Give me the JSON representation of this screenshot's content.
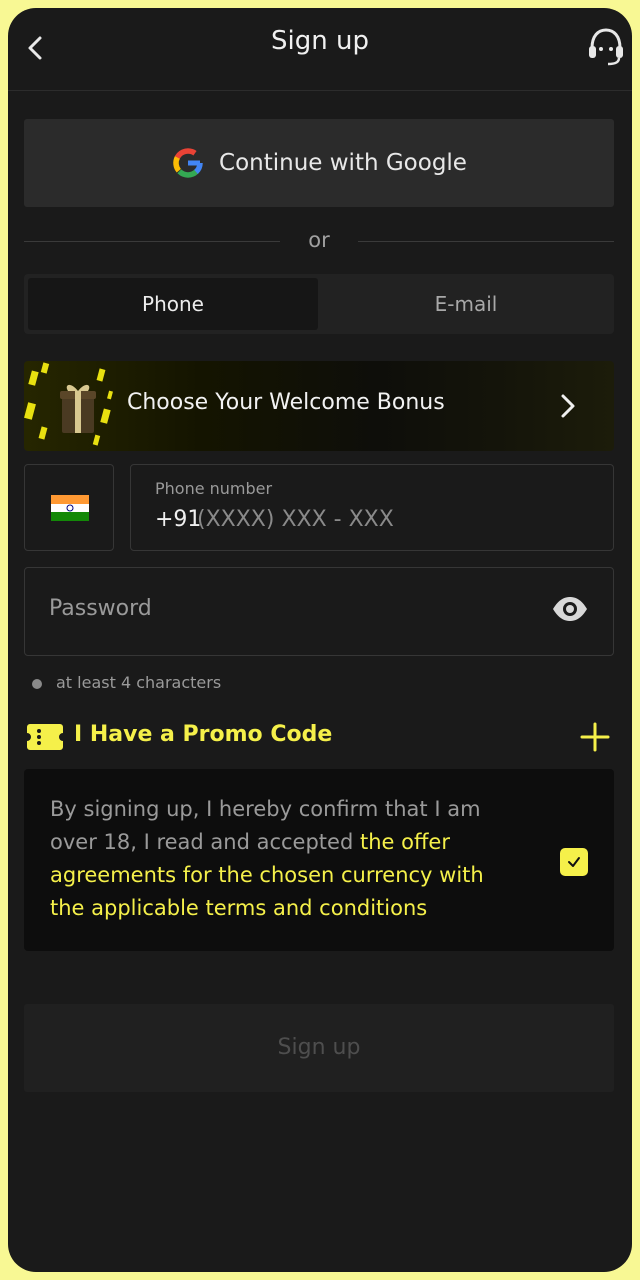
{
  "header": {
    "title": "Sign up",
    "back_icon": "chevron-left-icon",
    "support_icon": "headset-support-icon"
  },
  "google": {
    "label": "Continue with Google",
    "icon": "google-logo-icon"
  },
  "divider": {
    "text": "or"
  },
  "tabs": [
    {
      "label": "Phone",
      "active": true
    },
    {
      "label": "E-mail",
      "active": false
    }
  ],
  "bonus": {
    "label": "Choose Your Welcome Bonus",
    "icon": "gift-icon"
  },
  "phone": {
    "country_flag": "india-flag-icon",
    "label": "Phone number",
    "prefix": "+91",
    "placeholder": "(XXXX) XXX - XXX"
  },
  "password": {
    "placeholder": "Password",
    "toggle_icon": "eye-icon"
  },
  "password_hint": "at least 4 characters",
  "promo": {
    "label": "I Have a Promo Code",
    "icon": "ticket-icon",
    "expand_icon": "plus-icon"
  },
  "terms": {
    "text": "By signing up, I hereby confirm that I am over 18, I read and accepted ",
    "link": "the offer agreements for the chosen currency with the applicable terms and conditions",
    "checked": true
  },
  "submit": {
    "label": "Sign up"
  },
  "colors": {
    "accent": "#f5f04a",
    "background": "#1a1a1a",
    "frame": "#f8f894"
  }
}
